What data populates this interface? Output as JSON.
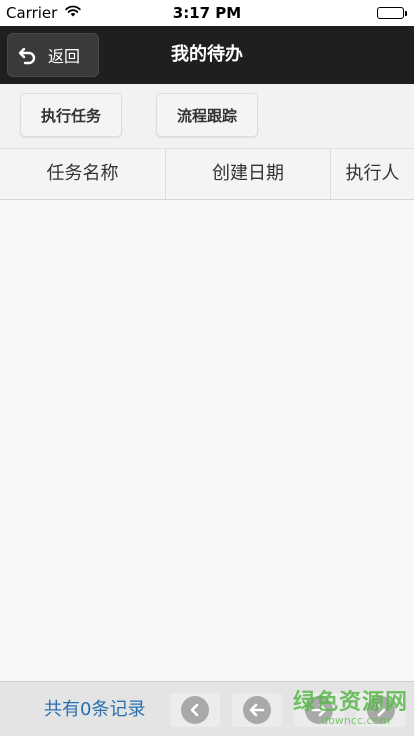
{
  "status_bar": {
    "carrier": "Carrier",
    "time": "3:17 PM",
    "icons": [
      "wifi-icon",
      "battery-icon"
    ]
  },
  "nav": {
    "back_label": "返回",
    "back_icon": "undo-arrow-icon",
    "title": "我的待办"
  },
  "actions": {
    "execute_task": "执行任务",
    "process_tracking": "流程跟踪"
  },
  "table": {
    "columns": [
      "任务名称",
      "创建日期",
      "执行人"
    ],
    "rows": []
  },
  "footer": {
    "record_count": "共有0条记录",
    "pager_icons": [
      "chevron-left-icon",
      "arrow-left-icon",
      "arrow-right-icon",
      "chevron-right-icon"
    ]
  },
  "watermark": {
    "text": "绿色资源网",
    "url": "downcc.com"
  },
  "colors": {
    "nav_background": "#1f1f1f",
    "record_count_text": "#2a6fb0",
    "watermark": "#59b84a"
  }
}
